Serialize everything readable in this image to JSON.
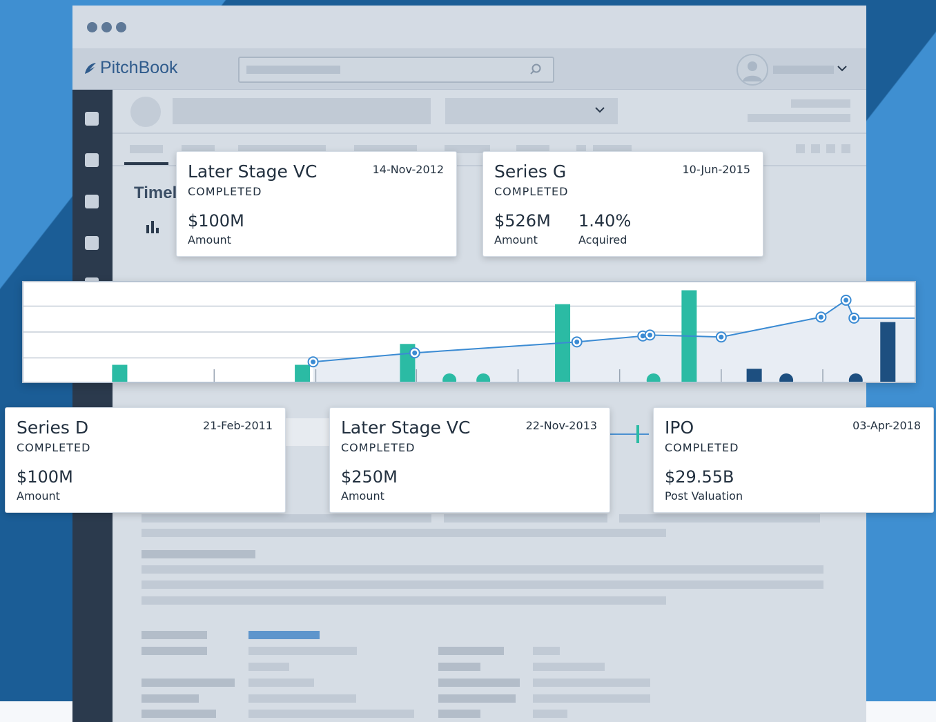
{
  "app": {
    "brand": "PitchBook",
    "timeline_heading": "Timel"
  },
  "colors": {
    "accent_teal": "#2bbba4",
    "accent_navy": "#1d4f80",
    "line_blue": "#3b8bd3",
    "sidebar": "#2b3a4d"
  },
  "icons": [
    "search-icon",
    "user-icon",
    "chevron-down-icon",
    "bar-chart-icon",
    "pitchbook-leaf-icon"
  ],
  "cards_top": [
    {
      "title": "Later Stage VC",
      "date": "14-Nov-2012",
      "status": "COMPLETED",
      "metrics": [
        {
          "value": "$100M",
          "label": "Amount"
        }
      ]
    },
    {
      "title": "Series G",
      "date": "10-Jun-2015",
      "status": "COMPLETED",
      "metrics": [
        {
          "value": "$526M",
          "label": "Amount"
        },
        {
          "value": "1.40%",
          "label": "Acquired"
        }
      ]
    }
  ],
  "cards_bottom": [
    {
      "title": "Series D",
      "date": "21-Feb-2011",
      "status": "COMPLETED",
      "metrics": [
        {
          "value": "$100M",
          "label": "Amount"
        }
      ]
    },
    {
      "title": "Later Stage VC",
      "date": "22-Nov-2013",
      "status": "COMPLETED",
      "metrics": [
        {
          "value": "$250M",
          "label": "Amount"
        }
      ]
    },
    {
      "title": "IPO",
      "date": "03-Apr-2018",
      "status": "COMPLETED",
      "metrics": [
        {
          "value": "$29.55B",
          "label": "Post Valuation"
        }
      ]
    }
  ],
  "chart_data": {
    "type": "bar",
    "title": "",
    "xlabel": "",
    "ylabel": "",
    "grid": true,
    "ylim": [
      0,
      1
    ],
    "bars": [
      {
        "x": 0.108,
        "value": 0.17,
        "series": "teal"
      },
      {
        "x": 0.313,
        "value": 0.17,
        "series": "teal"
      },
      {
        "x": 0.431,
        "value": 0.38,
        "series": "teal"
      },
      {
        "x": 0.605,
        "value": 0.78,
        "series": "teal"
      },
      {
        "x": 0.747,
        "value": 0.92,
        "series": "teal"
      },
      {
        "x": 0.82,
        "value": 0.13,
        "series": "navy"
      },
      {
        "x": 0.97,
        "value": 0.6,
        "series": "navy"
      }
    ],
    "line_points": [
      {
        "x": 0.325,
        "value": 0.2
      },
      {
        "x": 0.439,
        "value": 0.29
      },
      {
        "x": 0.621,
        "value": 0.4
      },
      {
        "x": 0.695,
        "value": 0.46
      },
      {
        "x": 0.703,
        "value": 0.47
      },
      {
        "x": 0.783,
        "value": 0.45
      },
      {
        "x": 0.895,
        "value": 0.65
      },
      {
        "x": 0.923,
        "value": 0.82
      },
      {
        "x": 0.932,
        "value": 0.64
      },
      {
        "x": 1.0,
        "value": 0.64
      }
    ],
    "event_dots": [
      {
        "x": 0.478,
        "series": "teal"
      },
      {
        "x": 0.516,
        "series": "teal"
      },
      {
        "x": 0.707,
        "series": "teal"
      },
      {
        "x": 0.856,
        "series": "navy"
      },
      {
        "x": 0.934,
        "series": "navy"
      }
    ],
    "ticks_x": [
      0.1,
      0.214,
      0.328,
      0.441,
      0.555,
      0.669,
      0.783,
      0.897
    ]
  }
}
